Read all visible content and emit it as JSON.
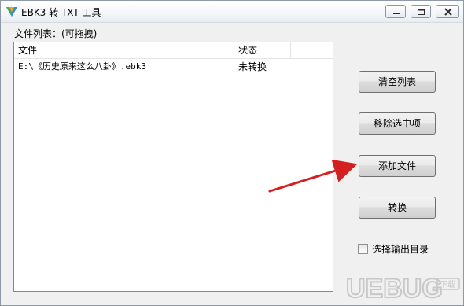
{
  "window": {
    "title": "EBK3 转 TXT 工具",
    "controls": {
      "minimize": "minimize",
      "maximize": "maximize",
      "close": "close"
    }
  },
  "list_label": "文件列表：(可拖拽)",
  "list": {
    "columns": [
      "文件",
      "状态",
      ""
    ],
    "rows": [
      {
        "file": "E:\\《历史原来这么八卦》.ebk3",
        "status": "未转换"
      }
    ]
  },
  "buttons": {
    "clear": "清空列表",
    "remove": "移除选中项",
    "add": "添加文件",
    "convert": "转换"
  },
  "checkbox": {
    "label": "选择输出目录",
    "checked": false
  },
  "watermark": {
    "text": "UEBUG",
    "sub": "下载"
  },
  "colors": {
    "arrow": "#d42020",
    "watermark": "#c8c8c8"
  }
}
